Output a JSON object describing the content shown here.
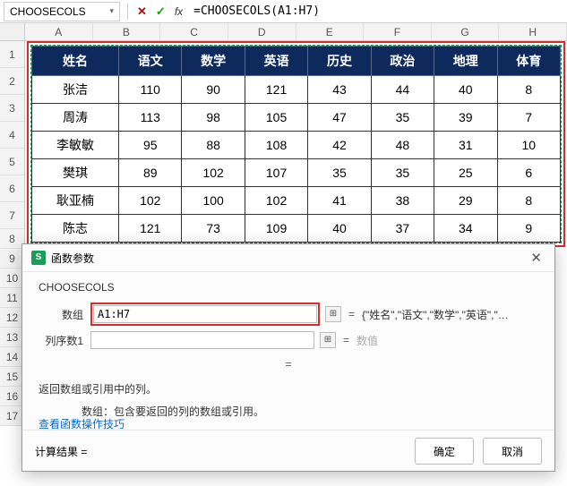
{
  "formula_bar": {
    "name_box": "CHOOSECOLS",
    "formula": "=CHOOSECOLS(A1:H7)"
  },
  "columns": [
    "A",
    "B",
    "C",
    "D",
    "E",
    "F",
    "G",
    "H"
  ],
  "rows_top": [
    "1",
    "2",
    "3",
    "4",
    "5",
    "6",
    "7"
  ],
  "rows_below": [
    "8",
    "9",
    "10",
    "11",
    "12",
    "13",
    "14",
    "15",
    "16",
    "17"
  ],
  "chart_data": {
    "type": "table",
    "headers": [
      "姓名",
      "语文",
      "数学",
      "英语",
      "历史",
      "政治",
      "地理",
      "体育"
    ],
    "rows": [
      [
        "张洁",
        "110",
        "90",
        "121",
        "43",
        "44",
        "40",
        "8"
      ],
      [
        "周涛",
        "113",
        "98",
        "105",
        "47",
        "35",
        "39",
        "7"
      ],
      [
        "李敏敏",
        "95",
        "88",
        "108",
        "42",
        "48",
        "31",
        "10"
      ],
      [
        "樊琪",
        "89",
        "102",
        "107",
        "35",
        "35",
        "25",
        "6"
      ],
      [
        "耿亚楠",
        "102",
        "100",
        "102",
        "41",
        "38",
        "29",
        "8"
      ],
      [
        "陈志",
        "121",
        "73",
        "109",
        "40",
        "37",
        "34",
        "9"
      ]
    ]
  },
  "dialog": {
    "title": "函数参数",
    "func_name": "CHOOSECOLS",
    "args": [
      {
        "label": "数组",
        "value": "A1:H7",
        "preview": "{\"姓名\",\"语文\",\"数学\",\"英语\",\"历史\",\"政治...",
        "highlight": true
      },
      {
        "label": "列序数1",
        "value": "",
        "preview": "数值",
        "dim": true
      }
    ],
    "result_eq": "=",
    "description": "返回数组或引用中的列。",
    "arg_detail": "数组：包含要返回的列的数组或引用。",
    "calc_label": "计算结果 =",
    "help_link": "查看函数操作技巧",
    "ok": "确定",
    "cancel": "取消"
  }
}
